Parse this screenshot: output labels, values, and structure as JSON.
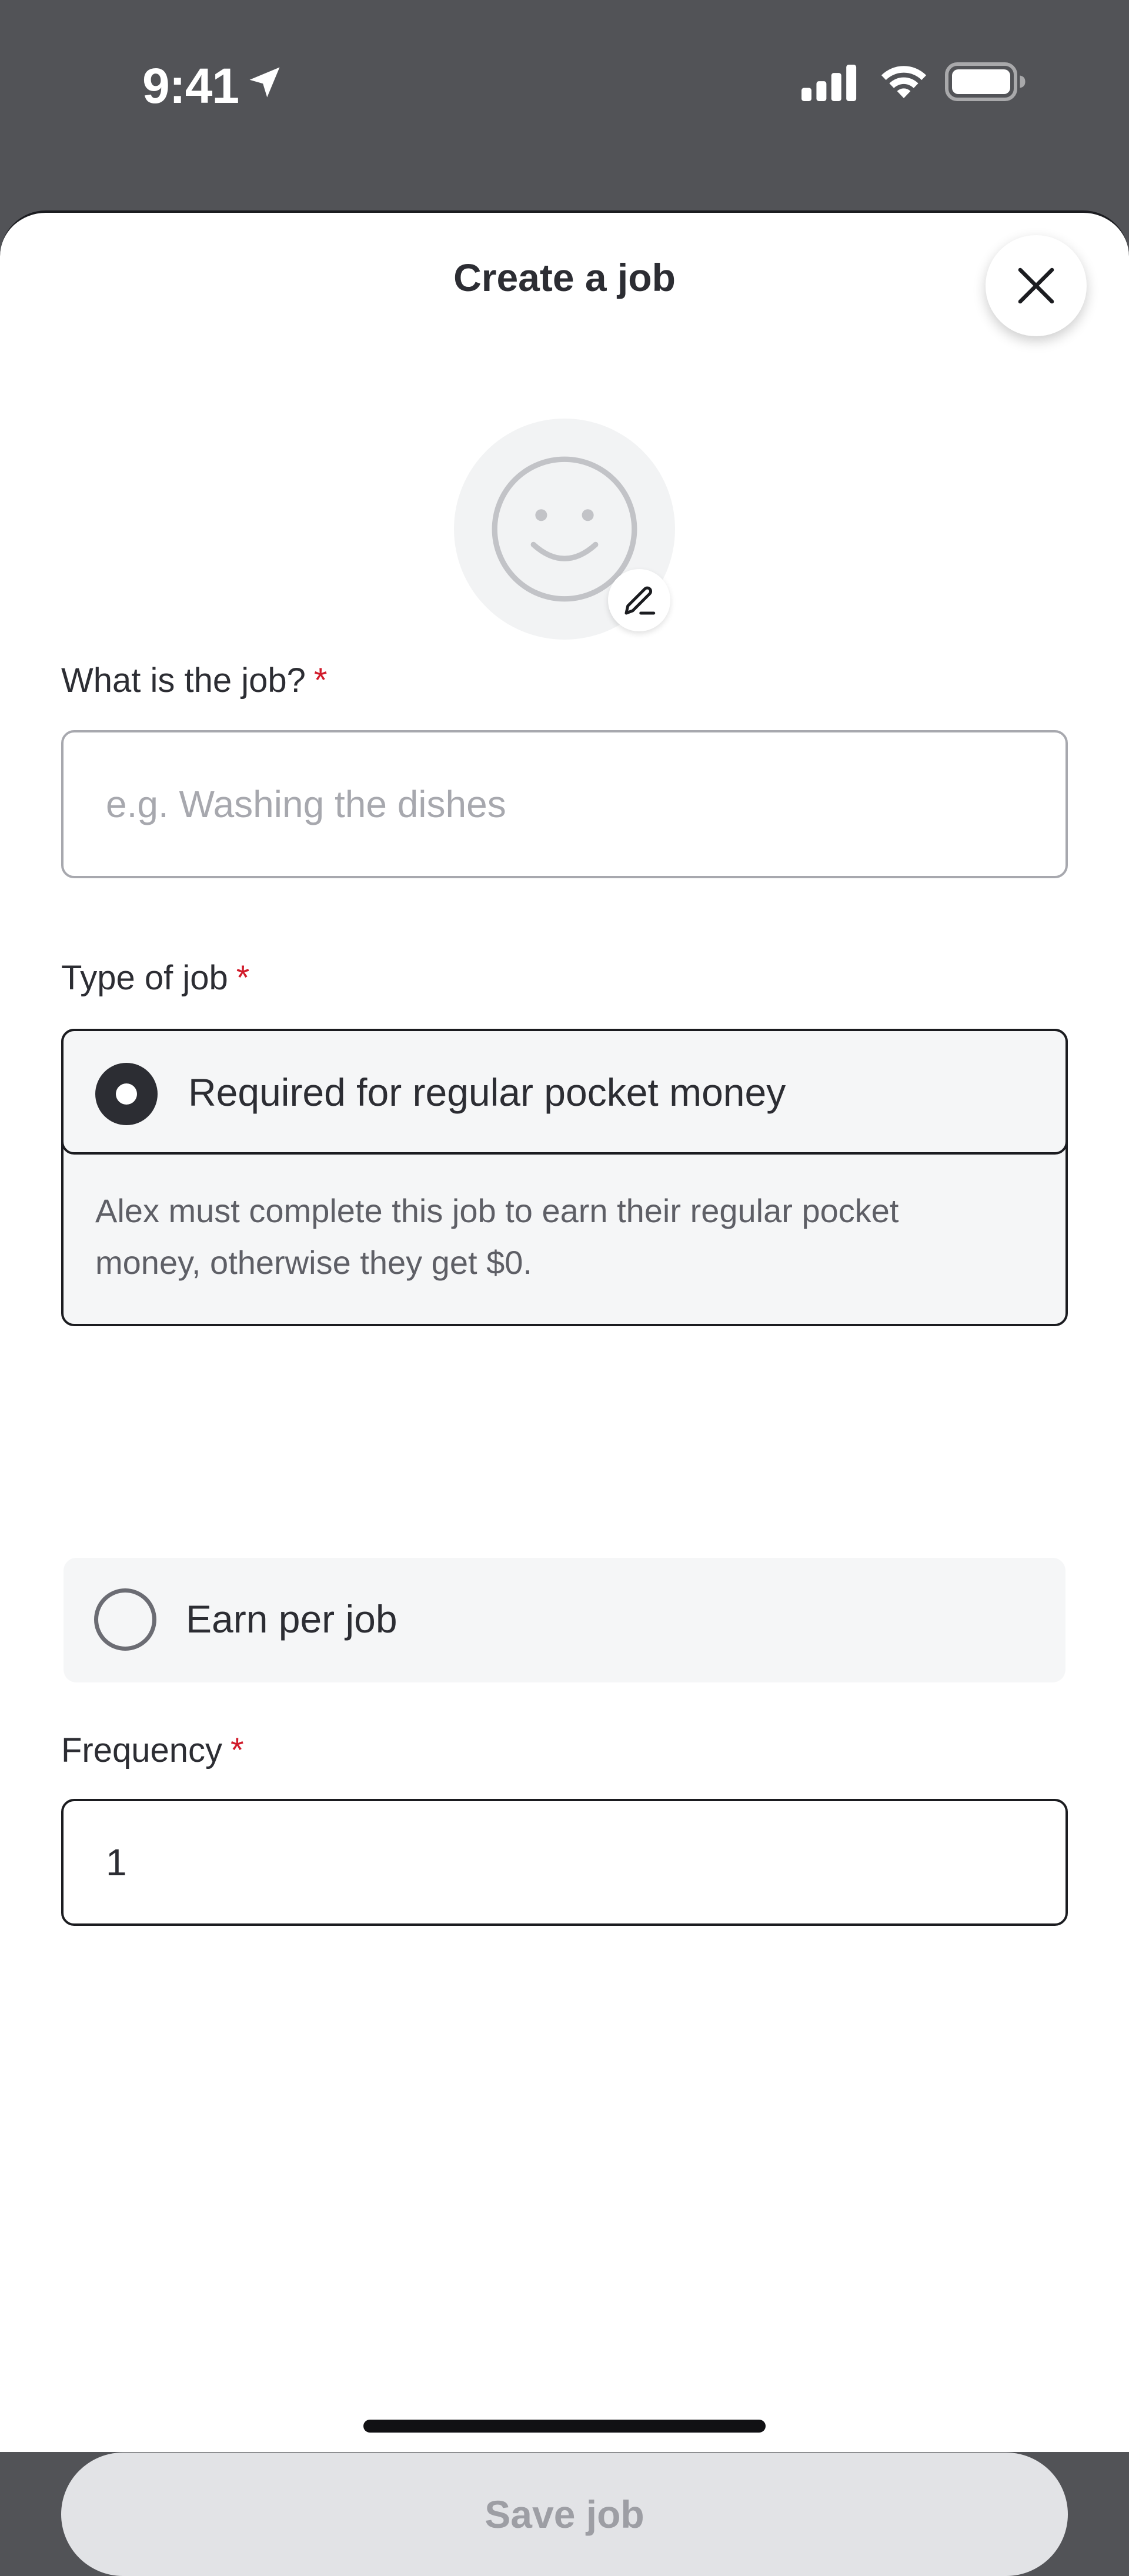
{
  "status_bar": {
    "time": "9:41",
    "icons": [
      "location-arrow-icon",
      "cellular-signal-icon",
      "wifi-icon",
      "battery-icon"
    ]
  },
  "sheet": {
    "title": "Create a job",
    "close_icon": "close-icon"
  },
  "avatar": {
    "icon": "smiley-face-icon",
    "edit_icon": "pencil-edit-icon"
  },
  "job_field": {
    "label": "What is the job?",
    "required_marker": "*",
    "placeholder": "e.g. Washing the dishes",
    "value": ""
  },
  "type_field": {
    "label": "Type of job",
    "required_marker": "*",
    "options": [
      {
        "label": "Required for regular pocket money",
        "selected": true,
        "description": "Alex must complete this job to earn their regular pocket money, otherwise they get $0."
      },
      {
        "label": "Earn per job",
        "selected": false
      }
    ]
  },
  "frequency_field": {
    "label": "Frequency",
    "required_marker": "*",
    "value": "1"
  },
  "actions": {
    "save_label": "Save job",
    "save_enabled": false
  },
  "colors": {
    "status_bar_bg": "#525357",
    "text_primary": "#2c2d33",
    "required": "#d11a2a",
    "option_bg": "#f5f6f7",
    "button_disabled_bg": "#e2e3e6",
    "button_disabled_text": "#9d9ea4"
  }
}
